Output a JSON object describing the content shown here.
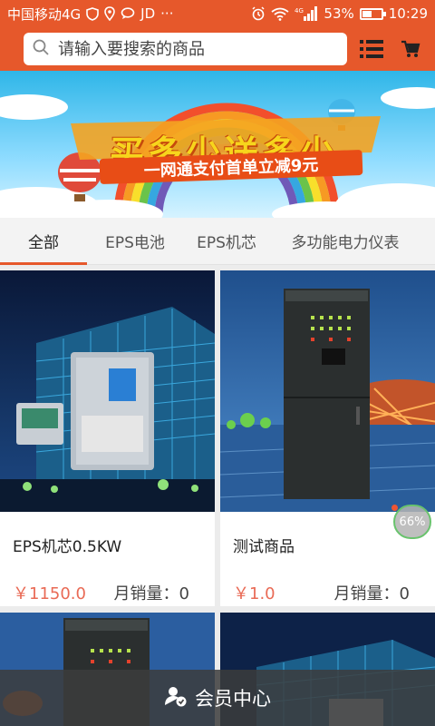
{
  "statusbar": {
    "carrier": "中国移动4G",
    "extra": "JD",
    "dots": "···",
    "network": "4G",
    "battery_pct": "53%",
    "battery_level": 0.53,
    "time": "10:29"
  },
  "search": {
    "placeholder": "请输入要搜索的商品"
  },
  "banner": {
    "title": "买多少送多少",
    "subtitle": "一网通支付首单立减9元"
  },
  "tabs": [
    "全部",
    "EPS电池",
    "EPS机芯",
    "多功能电力仪表"
  ],
  "products": [
    {
      "name": "EPS机芯0.5KW",
      "price": "￥1150.0",
      "sales": "月销量：0"
    },
    {
      "name": "测试商品",
      "price": "￥1.0",
      "sales": "月销量：0"
    }
  ],
  "progress_badge": "66%",
  "bottombar": {
    "label": "会员中心"
  },
  "colors": {
    "brand": "#e6582b",
    "price": "#e96a55"
  }
}
